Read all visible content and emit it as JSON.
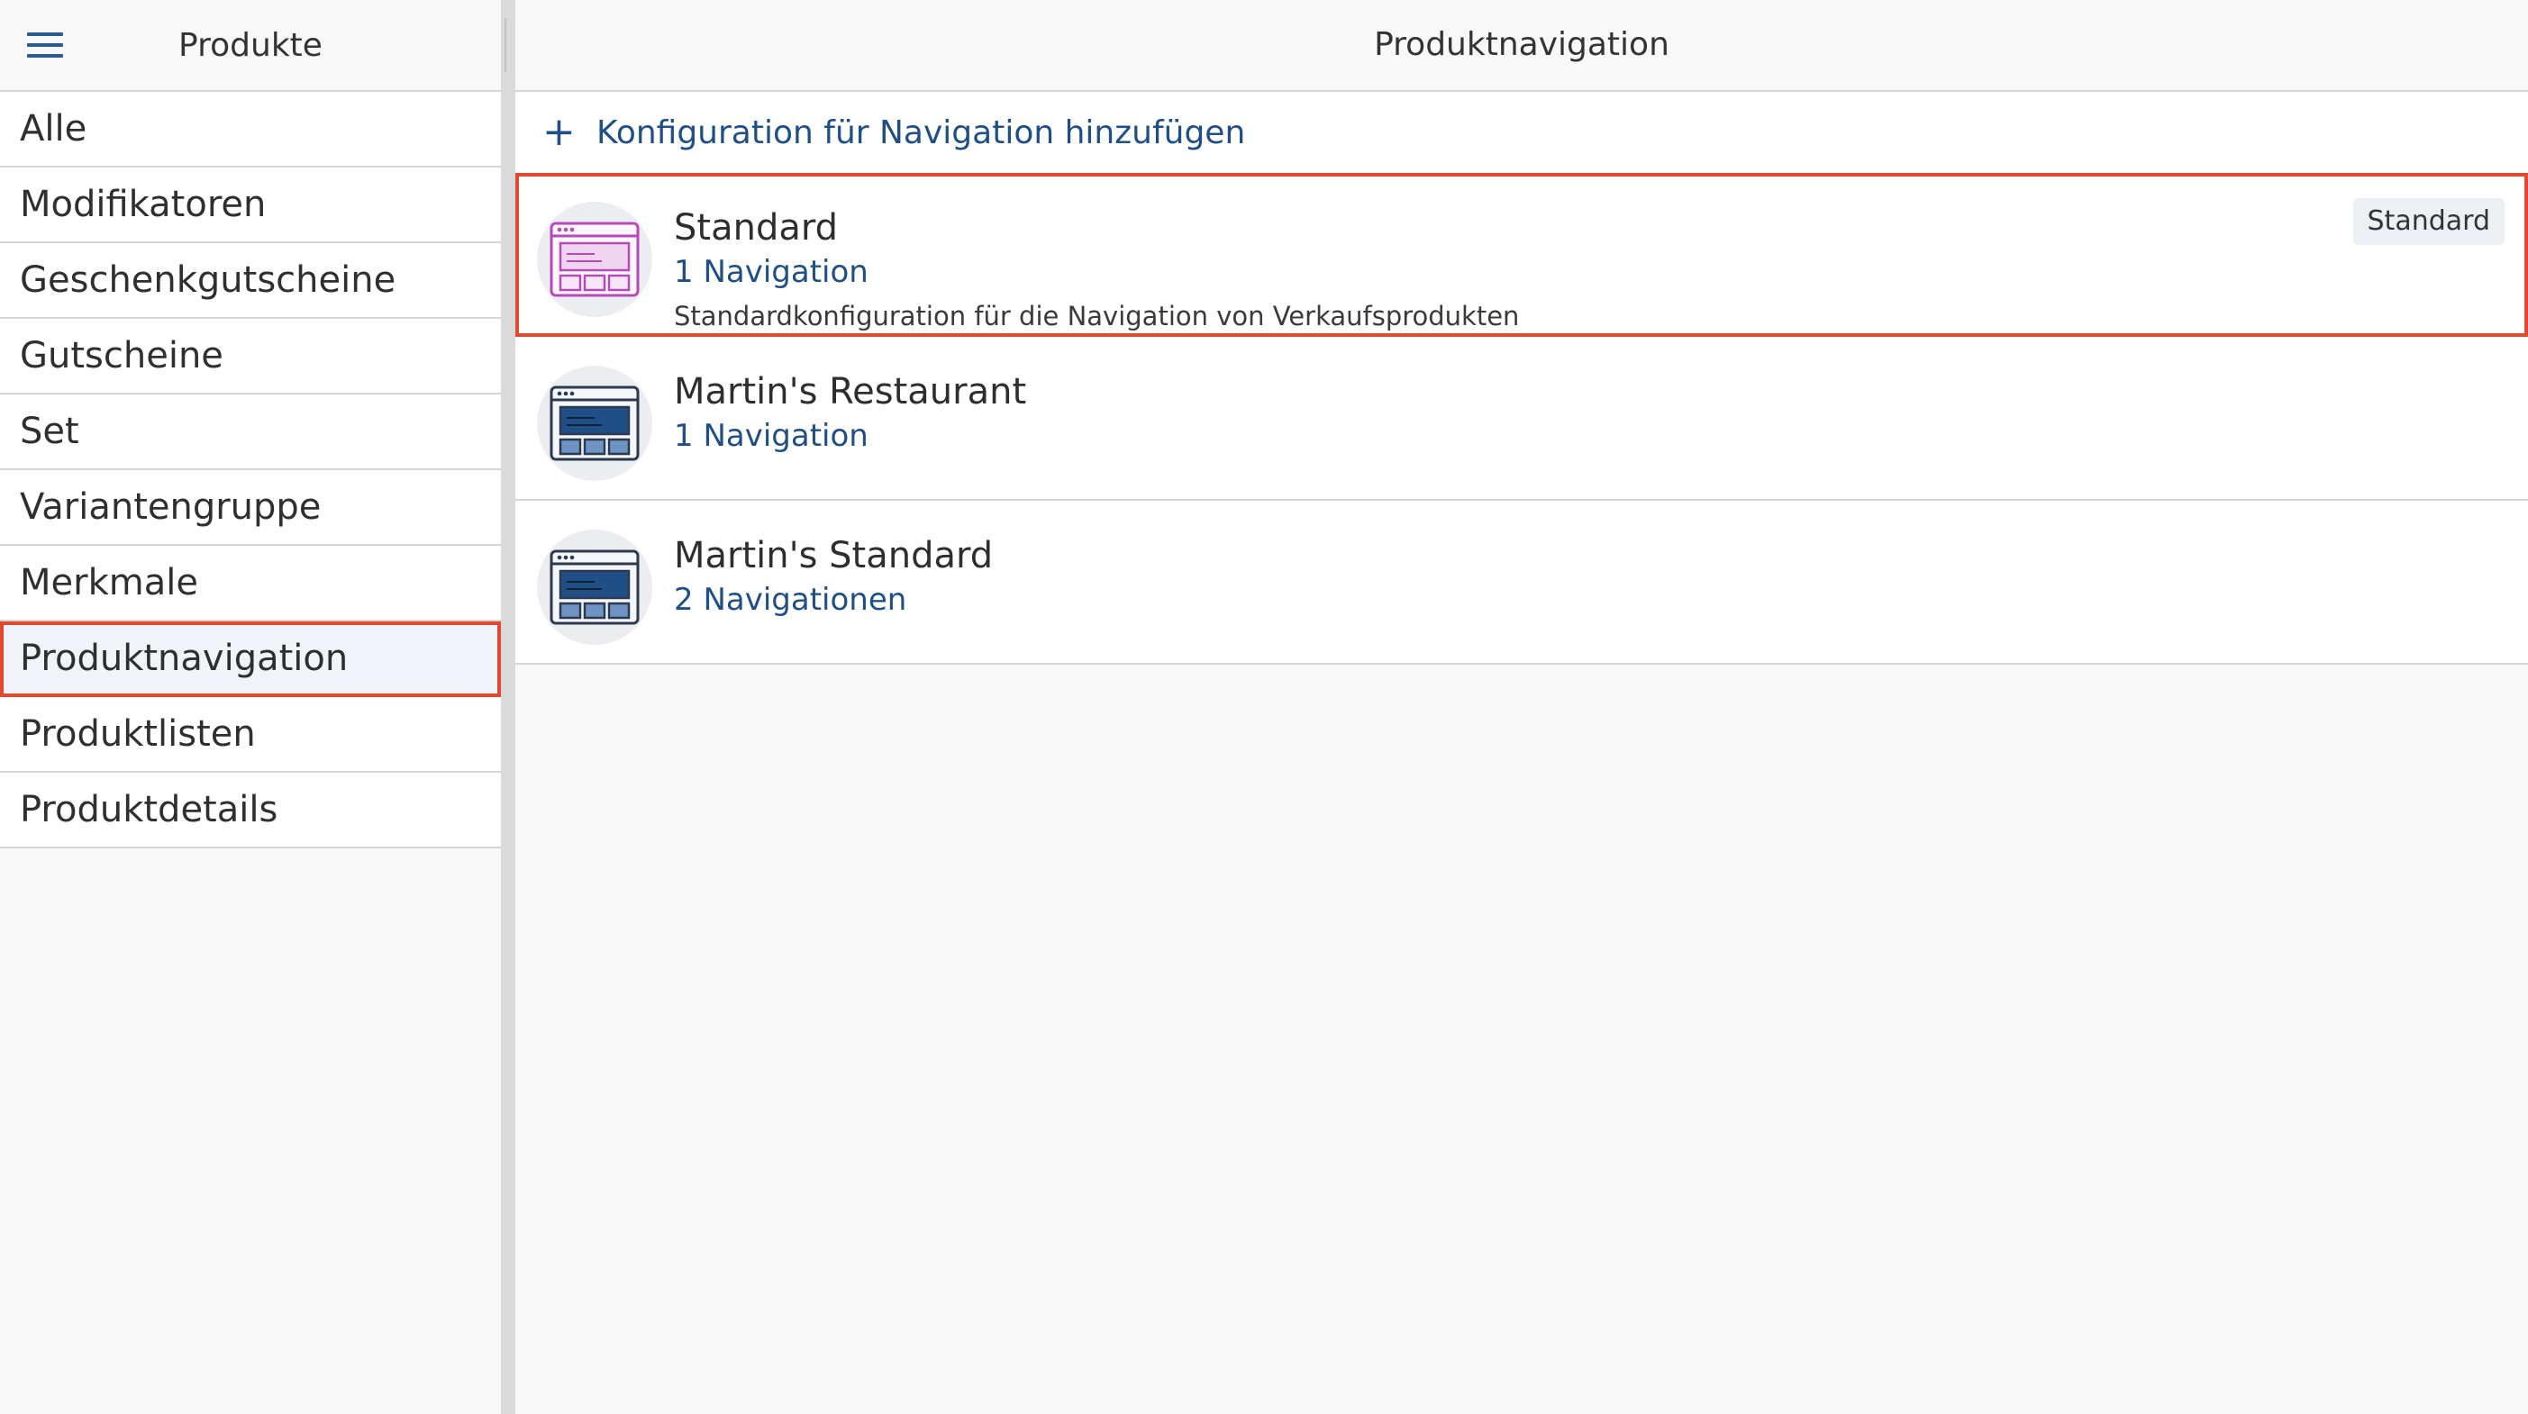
{
  "sidebar": {
    "title": "Produkte",
    "menu_icon": "hamburger-menu-icon",
    "items": [
      {
        "label": "Alle",
        "active": false
      },
      {
        "label": "Modifikatoren",
        "active": false
      },
      {
        "label": "Geschenkgutscheine",
        "active": false
      },
      {
        "label": "Gutscheine",
        "active": false
      },
      {
        "label": "Set",
        "active": false
      },
      {
        "label": "Variantengruppe",
        "active": false
      },
      {
        "label": "Merkmale",
        "active": false
      },
      {
        "label": "Produktnavigation",
        "active": true
      },
      {
        "label": "Produktlisten",
        "active": false
      },
      {
        "label": "Produktdetails",
        "active": false
      }
    ]
  },
  "main": {
    "title": "Produktnavigation",
    "add_config": {
      "icon": "plus-icon",
      "label": "Konfiguration für Navigation hinzufügen"
    },
    "configurations": [
      {
        "name": "Standard",
        "count": "1 Navigation",
        "description": "Standardkonfiguration für die Navigation von Verkaufsprodukten",
        "badge": "Standard",
        "icon": "layout-window-icon",
        "icon_color": "#b44bb8",
        "selected": true
      },
      {
        "name": "Martin's Restaurant",
        "count": "1 Navigation",
        "icon": "layout-window-icon",
        "icon_color": "#1f4f86",
        "selected": false
      },
      {
        "name": "Martin's Standard",
        "count": "2 Navigationen",
        "icon": "layout-window-icon",
        "icon_color": "#1f4f86",
        "selected": false
      }
    ]
  },
  "colors": {
    "accent": "#1f4f86",
    "highlight_border": "#e14a2e",
    "badge_background": "#eceff3"
  }
}
